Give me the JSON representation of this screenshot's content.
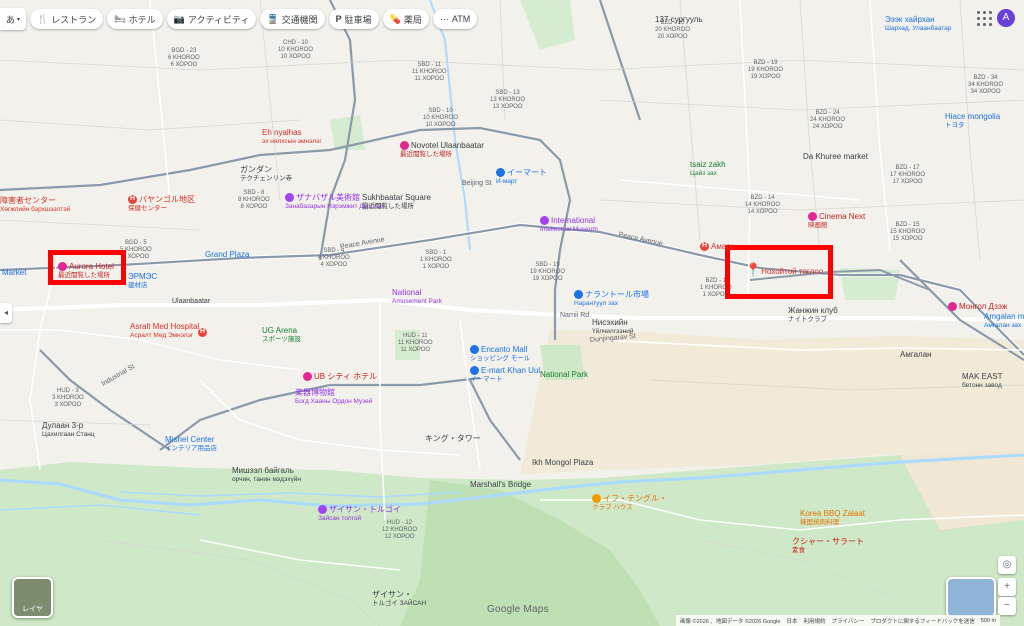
{
  "toolbar": {
    "ime_label": "あ",
    "chips": [
      {
        "icon": "fork-knife-icon",
        "glyph": "🍴",
        "label": "レストラン"
      },
      {
        "icon": "bed-icon",
        "glyph": "🛏",
        "label": "ホテル"
      },
      {
        "icon": "camera-icon",
        "glyph": "📷",
        "label": "アクティビティ"
      },
      {
        "icon": "transit-icon",
        "glyph": "🚆",
        "label": "交通機関"
      },
      {
        "icon": "parking-icon",
        "glyph": "P",
        "label": "駐車場"
      },
      {
        "icon": "pharmacy-icon",
        "glyph": "💊",
        "label": "薬局"
      },
      {
        "icon": "atm-icon",
        "glyph": "⋯",
        "label": "ATM"
      }
    ],
    "avatar_letter": "A"
  },
  "places": {
    "aurora": {
      "name": "Aurora Hotel",
      "sub": "最近閲覧した場所"
    },
    "nohoi": {
      "name": "Нохойтой тоглоо"
    },
    "novotel": {
      "name": "Novotel Ulaanbaatar",
      "sub": "最近閲覧した場所"
    },
    "gandan": {
      "name": "ガンダン",
      "sub": "テクチェンリン寺"
    },
    "bayanzurkh": {
      "name": "バヤンゴル地区",
      "sub": "保健センター"
    },
    "zanabazar": {
      "name": "ザナバザル美術館",
      "sub": "Занабазарын Нэрэмжит Дүрслэх"
    },
    "sukhbaatar": {
      "name": "Sukhbaatar Square",
      "sub": "最近閲覧した場所"
    },
    "intl_museum": {
      "name": "International",
      "sub": "Intellectual Museum"
    },
    "emart": {
      "name": "イーマート",
      "sub": "И-март"
    },
    "grandplaza": {
      "name": "Grand Plaza"
    },
    "amusement": {
      "name": "National",
      "sub": "Amusement Park"
    },
    "asralt": {
      "name": "Asralt Med Hospital",
      "sub": "Асралт Мед Эмнэлэг"
    },
    "ug_arena": {
      "name": "UG Arena",
      "sub": "スポーツ施設"
    },
    "ub_city": {
      "name": "UB シティ ホテル"
    },
    "state_museum": {
      "name": "楽器博物館",
      "sub": "Богд Хааны Ордон Музей"
    },
    "encanto": {
      "name": "Encanto Mall",
      "sub": "ショッピング モール"
    },
    "emart_khan": {
      "name": "E-mart Khan Uul",
      "sub": "イーマート"
    },
    "national_park": {
      "name": "National Park"
    },
    "narantuul": {
      "name": "ナラントール市場",
      "sub": "Нарантуул зах"
    },
    "cinema": {
      "name": "Cinema Next",
      "sub": "映画館"
    },
    "da_khuree": {
      "name": "Da Khuree market"
    },
    "tsaiz": {
      "name": "tsaiz zakh",
      "sub": "Цайз зах"
    },
    "hiace": {
      "name": "Hiace mongolia",
      "sub": "トヨタ"
    },
    "eh_nyalhas": {
      "name": "Eh nyalhas",
      "sub": "эх нялхсын эмнэлэг"
    },
    "zhanzhin": {
      "name": "Жанжин клуб",
      "sub": "ナイトクラブ"
    },
    "amgalan_mart": {
      "name": "Amgalan ma",
      "sub": "Амгалан зах"
    },
    "mongol_dz": {
      "name": "Монгол Дзэж"
    },
    "mak_east": {
      "name": "MAK EAST",
      "sub": "бетонн завод"
    },
    "king_tower": {
      "name": "キング・タワー"
    },
    "ikh_mongol": {
      "name": "Ikh Mongol Plaza"
    },
    "marshals": {
      "name": "Marshall's Bridge"
    },
    "seven": {
      "name": "イフ・テングル・",
      "sub": "クラブ ハウス"
    },
    "korea_bbq": {
      "name": "Korea BBQ Zalaat",
      "sub": "韓国焼肉料理"
    },
    "zaisan": {
      "name": "ザイサン・トルゴイ",
      "sub": "Зайсан толгой"
    },
    "zaisan_hill": {
      "name": "ザイサン・",
      "sub": "トルゴイ ЗАЙСАН"
    },
    "mishel": {
      "name": "Mishel Center",
      "sub": "インテリア用品店"
    },
    "dulaan": {
      "name": "Дулаан 3-р",
      "sub": "Цахилгаан Станц"
    },
    "mishel_sign": {
      "name": "Мишээл байгаль",
      "sub": "орчин, танин мэдэхүйн"
    },
    "amgalan_area": {
      "name": "Амгалан"
    },
    "sharkhad": {
      "name": "Эээк хайрхан",
      "sub": "Шархад, Улаанбаатар"
    },
    "bgd_top": {
      "name": "137 сургууль"
    },
    "khuzhaa": {
      "name": "クシャー・サラート",
      "sub": "素食"
    },
    "market_left": {
      "name": "Market"
    },
    "left_sign": {
      "name": "障害者センター",
      "sub": "Хөгжлийн бэрхшээлтэй"
    },
    "ulaanbaatar_mid": {
      "name": "Ulaanbaatar"
    },
    "peace_ave_1": {
      "name": "Peace Avenue"
    },
    "peace_ave_2": {
      "name": "Peace Avenue"
    },
    "nisekh": {
      "name": "Нисэхийн",
      "sub": "Үйлчилгээний"
    },
    "ermes": {
      "name": "ЭРМЭС",
      "sub": "建材店"
    },
    "amgalan_r": {
      "name": "Amgalan"
    },
    "amarbaya": {
      "name": "Амарь"
    }
  },
  "districts": [
    "BGD - 23\n6 KHOROO\n6 ХОРОО",
    "CHD - 10\n10 KHOROO\n10 ХОРОО",
    "SBD - 11\n11 KHOROO\n11 ХОРОО",
    "SBD - 10\n10 KHOROO\n10 ХОРОО",
    "SBD - 13\n13 KHOROO\n13 ХОРОО",
    "BZD - 20\n20 KHOROO\n20 ХОРОО",
    "BZD - 19\n19 KHOROO\n19 ХОРОО",
    "BZD - 24\n24 KHOROO\n24 ХОРОО",
    "BZD - 17\n17 KHOROO\n17 ХОРОО",
    "BZD - 15\n15 KHOROO\n15 ХОРОО",
    "BZD - 14\n14 KHOROO\n14 ХОРОО",
    "BZD - 1\n1 KHOROO\n1 ХОРОО",
    "SBD - 8\n8 KHOROO\n8 ХОРОО",
    "SBD - 4\n4 KHOROO\n4 ХОРОО",
    "SBD - 1\n1 KHOROO\n1 ХОРОО",
    "HUD - 3\n3 KHOROO\n3 ХОРОО",
    "HUD - 11\n11 KHOROO\n11 ХОРОО",
    "BGD - 5\n5 KHOROO\n5 ХОРОО",
    "SBD - 19\n19 KHOROO\n19 ХОРОО",
    "HUD - 12\n12 KHOROO\n12 ХОРОО",
    "BZD - 34\n34 KHOROO\n34 ХОРОО"
  ],
  "roads": [
    "Peace Avenue",
    "Chinggis Avenue",
    "Industrial St",
    "Dunjingarav St",
    "Narnii Rd",
    "Beijing St"
  ],
  "brand": "Google Maps",
  "footer": {
    "copyright": "画像 ©2026 、地図データ ©2026 Google",
    "items": [
      "日本",
      "利用規約",
      "プライバシー",
      "プロダクトに関するフィードバックを送信",
      "500 m"
    ]
  },
  "layers_label": "レイヤ",
  "colors": {
    "highlight": "#ff0000",
    "hotel": "#e52592",
    "museum": "#a142f4",
    "shop": "#1a73e8",
    "park": "#34a853",
    "hospital": "#e94235"
  }
}
